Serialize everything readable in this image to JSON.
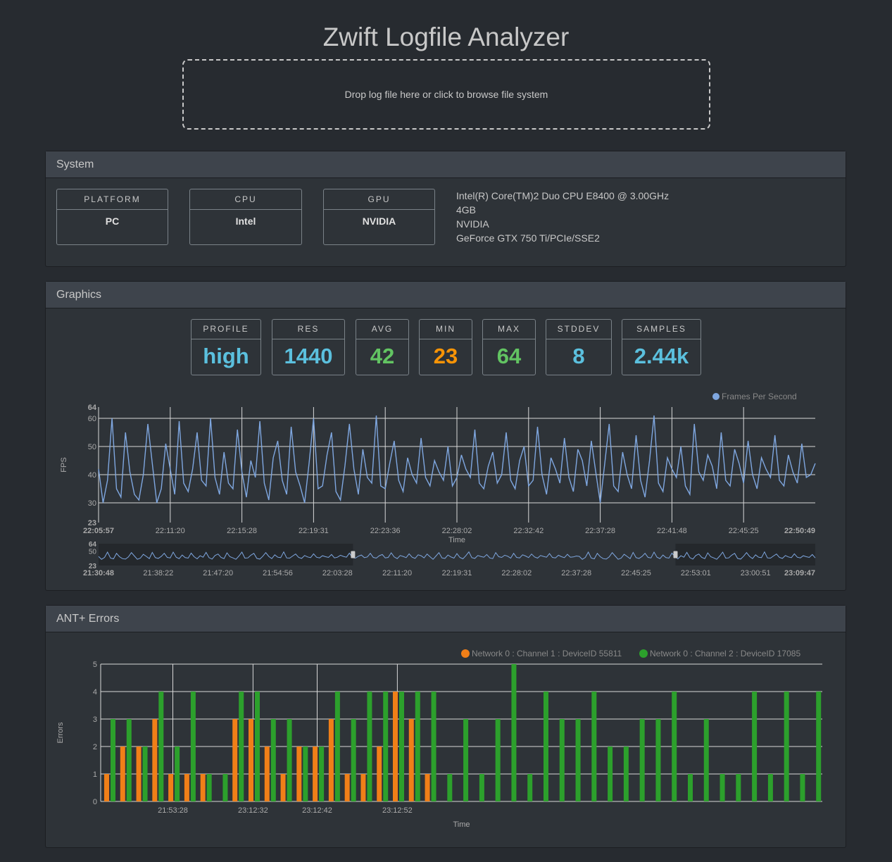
{
  "app": {
    "title": "Zwift Logfile Analyzer",
    "dropzone_text": "Drop log file here or click to browse file system"
  },
  "system": {
    "heading": "System",
    "boxes": [
      {
        "label": "PLATFORM",
        "value": "PC"
      },
      {
        "label": "CPU",
        "value": "Intel"
      },
      {
        "label": "GPU",
        "value": "NVIDIA"
      }
    ],
    "details": [
      "Intel(R) Core(TM)2 Duo CPU E8400 @ 3.00GHz",
      "4GB",
      "NVIDIA",
      "GeForce GTX 750 Ti/PCIe/SSE2"
    ]
  },
  "graphics": {
    "heading": "Graphics",
    "stats": [
      {
        "label": "PROFILE",
        "value": "high",
        "color": "#5bc0de"
      },
      {
        "label": "RES",
        "value": "1440",
        "color": "#5bc0de"
      },
      {
        "label": "AVG",
        "value": "42",
        "color": "#62c462"
      },
      {
        "label": "MIN",
        "value": "23",
        "color": "#f89406"
      },
      {
        "label": "MAX",
        "value": "64",
        "color": "#62c462"
      },
      {
        "label": "STDDEV",
        "value": "8",
        "color": "#5bc0de"
      },
      {
        "label": "SAMPLES",
        "value": "2.44k",
        "color": "#5bc0de"
      }
    ]
  },
  "ant": {
    "heading": "ANT+ Errors"
  },
  "chart_data": [
    {
      "type": "line",
      "ylabel": "FPS",
      "xlabel": "Time",
      "legend": [
        "Frames Per Second"
      ],
      "legend_position": "top-right",
      "line_color": "#7fa7e0",
      "ylim": [
        23,
        64
      ],
      "yticks": [
        "64",
        "60",
        "50",
        "40",
        "30",
        "23"
      ],
      "xticks": [
        "22:05:57",
        "22:11:20",
        "22:15:28",
        "22:19:31",
        "22:23:36",
        "22:28:02",
        "22:32:42",
        "22:37:28",
        "22:41:48",
        "22:45:25",
        "22:50:49"
      ],
      "grid": true,
      "values": [
        42,
        30,
        38,
        60,
        35,
        32,
        55,
        41,
        33,
        31,
        40,
        58,
        44,
        30,
        35,
        51,
        42,
        33,
        59,
        37,
        34,
        42,
        55,
        38,
        36,
        60,
        39,
        33,
        48,
        37,
        35,
        56,
        41,
        32,
        45,
        39,
        59,
        37,
        31,
        46,
        52,
        38,
        33,
        57,
        41,
        36,
        30,
        44,
        60,
        35,
        36,
        47,
        55,
        34,
        31,
        43,
        58,
        42,
        33,
        49,
        39,
        37,
        61,
        36,
        35,
        44,
        52,
        38,
        34,
        46,
        40,
        37,
        53,
        39,
        36,
        45,
        41,
        38,
        50,
        36,
        39,
        47,
        42,
        39,
        56,
        37,
        35,
        43,
        48,
        37,
        40,
        55,
        38,
        35,
        45,
        50,
        36,
        38,
        57,
        40,
        33,
        46,
        42,
        37,
        53,
        39,
        34,
        49,
        45,
        36,
        52,
        41,
        30,
        44,
        58,
        36,
        34,
        48,
        40,
        35,
        54,
        38,
        32,
        45,
        61,
        37,
        34,
        46,
        42,
        39,
        50,
        36,
        33,
        58,
        41,
        38,
        47,
        43,
        35,
        55,
        38,
        36,
        49,
        44,
        37,
        52,
        40,
        35,
        46,
        42,
        39,
        54,
        38,
        36,
        47,
        41,
        37,
        51,
        39,
        40,
        44
      ],
      "navigator": {
        "xticks": [
          "21:30:48",
          "21:38:22",
          "21:47:20",
          "21:54:56",
          "22:03:28",
          "22:11:20",
          "22:19:31",
          "22:28:02",
          "22:37:28",
          "22:45:25",
          "22:53:01",
          "23:00:51",
          "23:09:47"
        ],
        "yticks": [
          "64",
          "50",
          "23"
        ],
        "window": [
          0.355,
          0.805
        ]
      }
    },
    {
      "type": "bar",
      "ylabel": "Errors",
      "xlabel": "Time",
      "ylim": [
        0,
        5
      ],
      "yticks": [
        "5",
        "4",
        "3",
        "2",
        "1",
        "0"
      ],
      "xticks": [
        "21:53:28",
        "23:12:32",
        "23:12:42",
        "23:12:52"
      ],
      "legend_position": "top-right",
      "grid": true,
      "series": [
        {
          "name": "Network 0 : Channel 1 : DeviceID 55811",
          "color": "#f07f18",
          "values": [
            1,
            2,
            2,
            3,
            1,
            1,
            1,
            0,
            3,
            3,
            2,
            1,
            2,
            2,
            3,
            1,
            1,
            2,
            4,
            3,
            1,
            0,
            0,
            0,
            0,
            0,
            0,
            0,
            0,
            0,
            0,
            0,
            0,
            0,
            0,
            0,
            0,
            0,
            0,
            0,
            0,
            0,
            0,
            0,
            0
          ]
        },
        {
          "name": "Network 0 : Channel 2 : DeviceID 17085",
          "color": "#2ca02c",
          "values": [
            3,
            3,
            2,
            4,
            2,
            4,
            1,
            1,
            4,
            4,
            3,
            3,
            2,
            2,
            4,
            3,
            4,
            4,
            4,
            4,
            4,
            1,
            3,
            1,
            3,
            5,
            1,
            4,
            3,
            3,
            4,
            2,
            2,
            3,
            3,
            4,
            1,
            3,
            1,
            1,
            4,
            1,
            4,
            1,
            4
          ]
        }
      ]
    }
  ]
}
